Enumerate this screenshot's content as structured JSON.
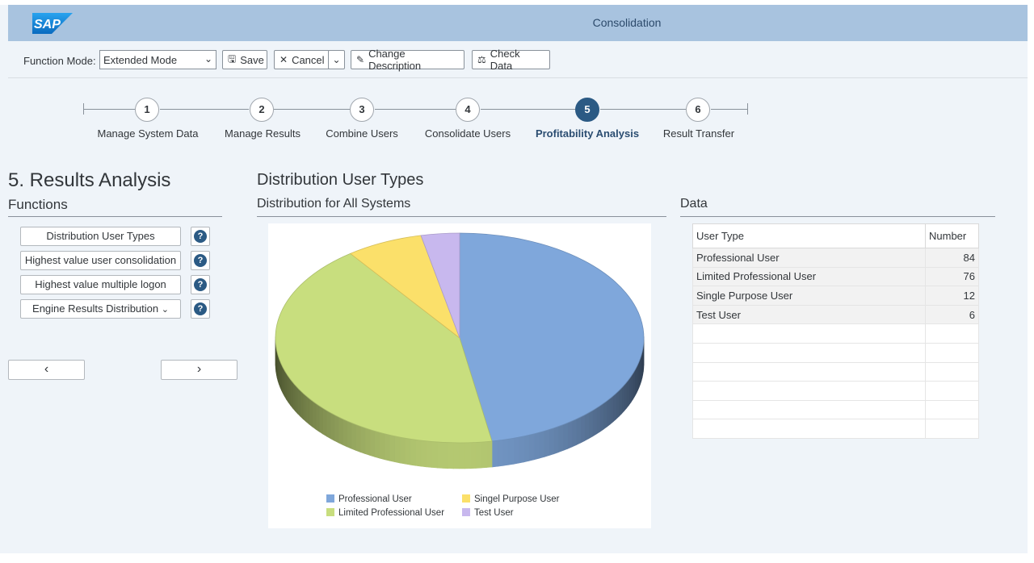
{
  "shell": {
    "logo_text": "SAP",
    "title": "Consolidation"
  },
  "toolbar": {
    "function_mode_label": "Function Mode:",
    "function_mode_value": "Extended Mode",
    "save_label": "Save",
    "cancel_label": "Cancel",
    "change_description_label": "Change Description",
    "check_data_label": "Check Data"
  },
  "roadmap": {
    "active_step": 5,
    "steps": [
      {
        "number": "1",
        "label": "Manage System Data"
      },
      {
        "number": "2",
        "label": "Manage Results"
      },
      {
        "number": "3",
        "label": "Combine Users"
      },
      {
        "number": "4",
        "label": "Consolidate Users"
      },
      {
        "number": "5",
        "label": "Profitability Analysis"
      },
      {
        "number": "6",
        "label": "Result Transfer"
      }
    ]
  },
  "left": {
    "title": "5. Results Analysis",
    "functions_title": "Functions",
    "functions": [
      {
        "label": "Distribution User Types",
        "help": "?"
      },
      {
        "label": "Highest value user consolidation",
        "help": "?"
      },
      {
        "label": "Highest value multiple logon",
        "help": "?"
      },
      {
        "label": "Engine Results Distribution",
        "help": "?",
        "has_dropdown": true
      }
    ],
    "prev_icon": "chevron-left-icon",
    "next_icon": "chevron-right-icon"
  },
  "chart": {
    "title": "Distribution User Types",
    "subtitle": "Distribution for All Systems"
  },
  "chart_data": {
    "type": "pie",
    "style": "3d",
    "slices": [
      {
        "label": "Professional User",
        "value": 84,
        "color": "#7fa7db"
      },
      {
        "label": "Limited Professional User",
        "value": 76,
        "color": "#c8de7e"
      },
      {
        "label": "Singel Purpose User",
        "value": 12,
        "color": "#fbe06a"
      },
      {
        "label": "Test User",
        "value": 6,
        "color": "#c8b8ee"
      }
    ],
    "legend": [
      {
        "label": "Professional User",
        "color": "#7fa7db"
      },
      {
        "label": "Singel Purpose User",
        "color": "#fbe06a"
      },
      {
        "label": "Limited Professional User",
        "color": "#c8de7e"
      },
      {
        "label": "Test User",
        "color": "#c8b8ee"
      }
    ],
    "legend_position": "bottom"
  },
  "data_panel": {
    "title": "Data",
    "columns": [
      "User Type",
      "Number"
    ],
    "rows": [
      {
        "type": "Professional User",
        "number": "84"
      },
      {
        "type": "Limited Professional User",
        "number": "76"
      },
      {
        "type": "Single Purpose User",
        "number": "12"
      },
      {
        "type": "Test User",
        "number": "6"
      }
    ]
  },
  "colors": {
    "shell_bg": "#a8c3df",
    "page_bg": "#eff4f9",
    "active_step": "#2b5a84",
    "sap_blue": "#1a8ad6"
  }
}
